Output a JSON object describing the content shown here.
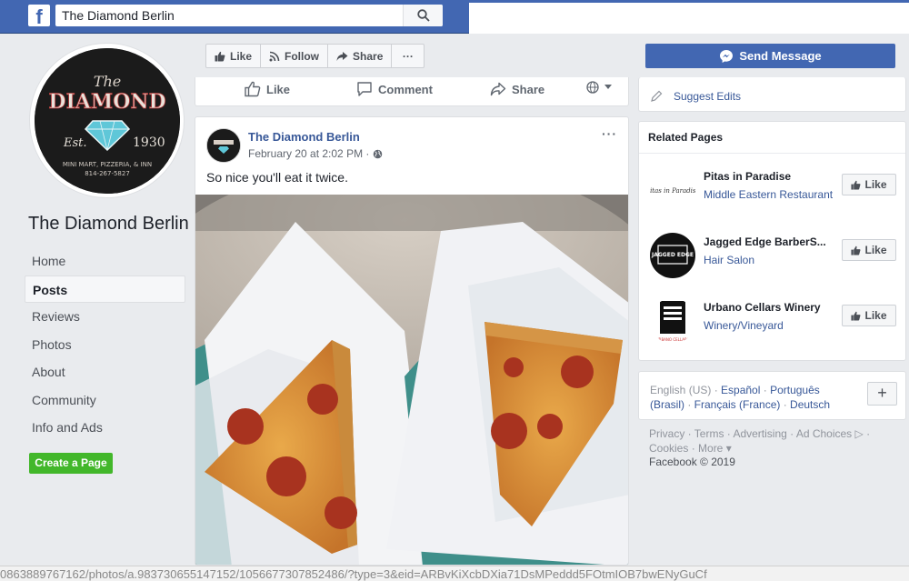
{
  "topbar": {
    "logo": "f",
    "search_value": "The Diamond Berlin",
    "search_icon": "search-icon"
  },
  "profile": {
    "logo_line1": "The",
    "logo_line2": "DIAMOND",
    "logo_est": "Est.",
    "logo_year": "1930",
    "logo_tagline": "MINI MART, PIZZERIA, & INN",
    "logo_phone": "814-267-5827",
    "page_name": "The Diamond Berlin"
  },
  "nav": {
    "items": [
      {
        "label": "Home"
      },
      {
        "label": "Posts"
      },
      {
        "label": "Reviews"
      },
      {
        "label": "Photos"
      },
      {
        "label": "About"
      },
      {
        "label": "Community"
      },
      {
        "label": "Info and Ads"
      }
    ],
    "create_page": "Create a Page"
  },
  "actions": {
    "like": "Like",
    "follow": "Follow",
    "share": "Share",
    "more": "···"
  },
  "like_bar": {
    "like": "Like",
    "comment": "Comment",
    "share": "Share"
  },
  "post": {
    "author": "The Diamond Berlin",
    "date": "February 20 at 2:02 PM · ",
    "text": "So nice you'll eat it twice.",
    "menu": "···"
  },
  "right": {
    "send_message": "Send Message",
    "suggest_edits": "Suggest Edits",
    "related_title": "Related Pages",
    "related": [
      {
        "name": "Pitas in Paradise",
        "category": "Middle Eastern Restaurant",
        "logo_text": "Pitas in Paradise",
        "like": "Like"
      },
      {
        "name": "Jagged Edge BarberS...",
        "category": "Hair Salon",
        "logo_text": "JAGGED EDGE",
        "like": "Like"
      },
      {
        "name": "Urbano Cellars Winery",
        "category": "Winery/Vineyard",
        "logo_text": "URBANO CELLARS",
        "like": "Like"
      }
    ]
  },
  "languages": {
    "current": "English (US)",
    "list": [
      "Español",
      "Português (Brasil)",
      "Français (France)",
      "Deutsch"
    ],
    "plus": "+"
  },
  "footer": {
    "line1": "Privacy · Terms · Advertising · Ad Choices ▷ ·",
    "line2": "Cookies · More ▾",
    "copyright": "Facebook © 2019"
  },
  "status_url": "0863889767162/photos/a.983730655147152/1056677307852486/?type=3&eid=ARBvKiXcbDXia71DsMPeddd5FOtmIOB7bwENyGuCf",
  "colors": {
    "brand": "#4267b2",
    "link": "#385898",
    "create_green": "#42b72a"
  }
}
